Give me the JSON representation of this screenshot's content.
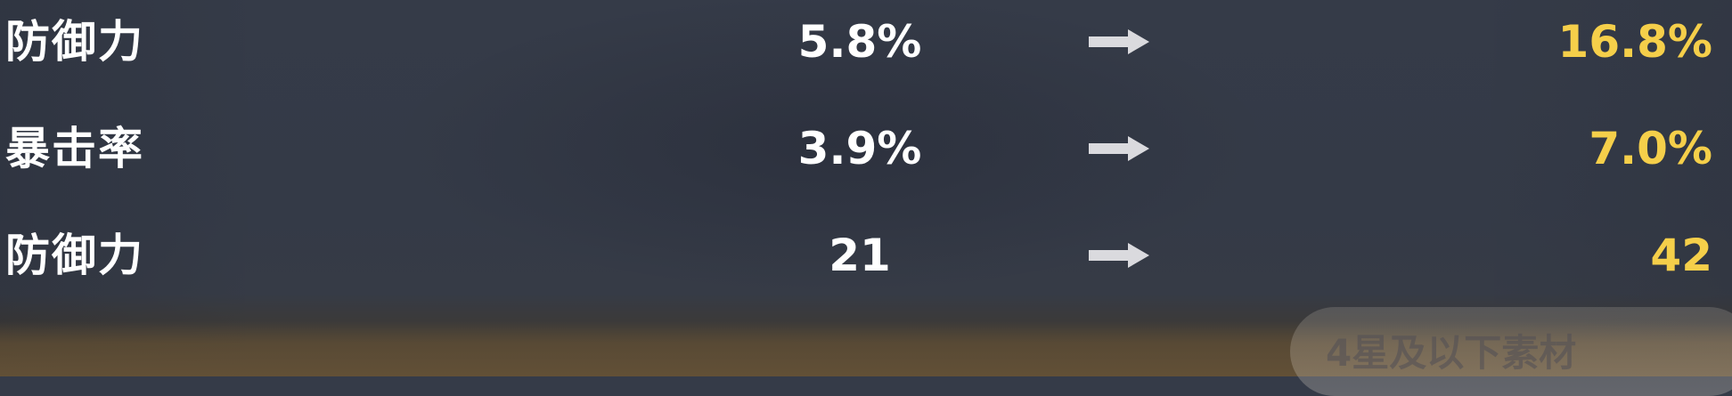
{
  "stats": [
    {
      "name": "防御力",
      "old": "5.8%",
      "new": "16.8%"
    },
    {
      "name": "暴击率",
      "old": "3.9%",
      "new": "7.0%"
    },
    {
      "name": "防御力",
      "old": "21",
      "new": "42"
    }
  ],
  "material_tag": {
    "label": "4星及以下素材"
  },
  "colors": {
    "background": "#353b48",
    "stat_text": "#ffffff",
    "upgraded_value": "#f5cf4a",
    "arrow": "#e6e6ea"
  },
  "icons": {
    "upgrade_arrow": "right-arrow-icon"
  }
}
